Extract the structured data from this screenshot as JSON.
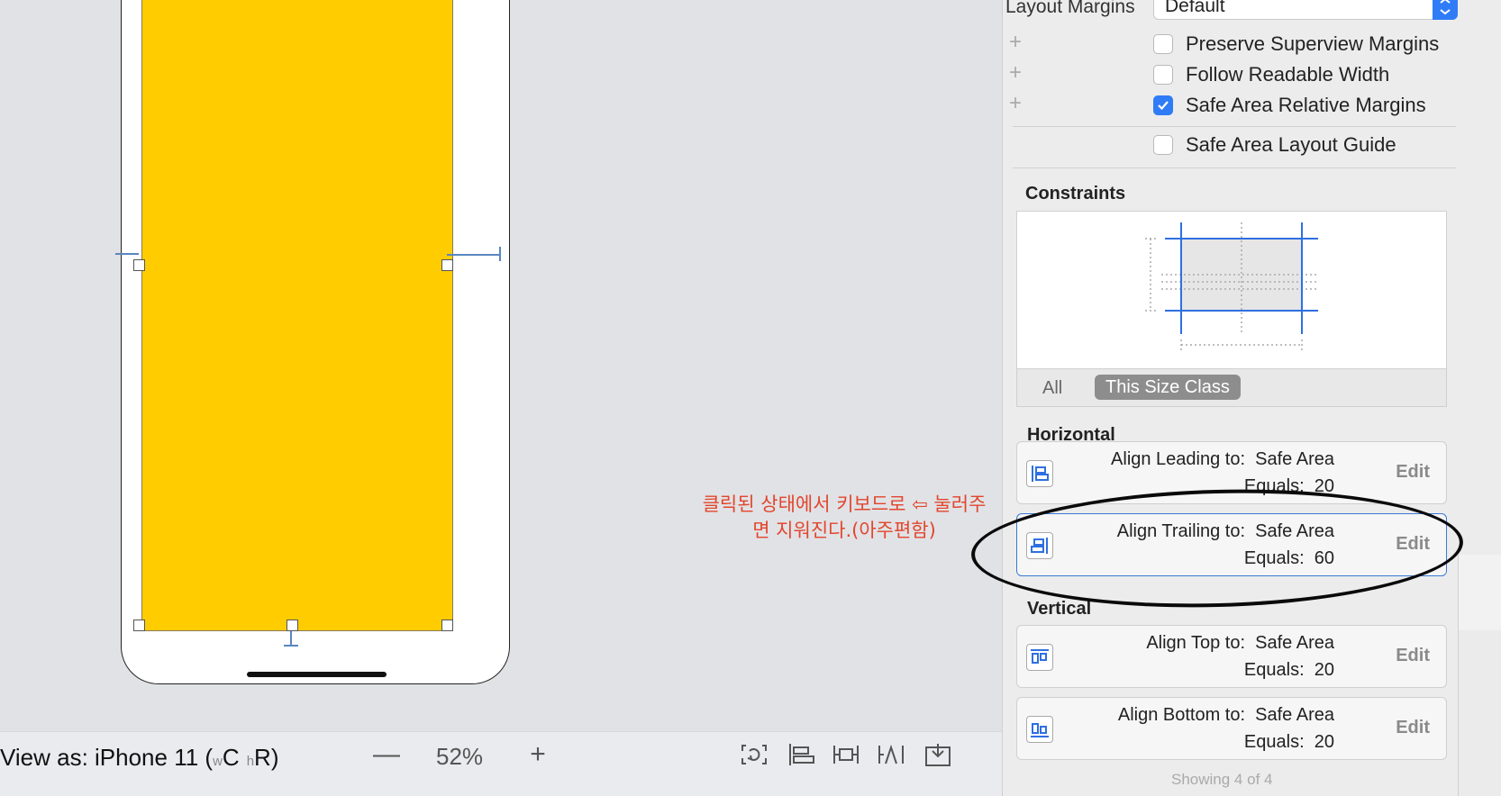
{
  "inspector": {
    "layout_margins_label": "Layout Margins",
    "layout_margins_value": "Default",
    "checkboxes": [
      {
        "label": "Preserve Superview Margins",
        "checked": false
      },
      {
        "label": "Follow Readable Width",
        "checked": false
      },
      {
        "label": "Safe Area Relative Margins",
        "checked": true
      },
      {
        "label": "Safe Area Layout Guide",
        "checked": false
      }
    ],
    "constraints_title": "Constraints",
    "size_class_tabs": [
      "All",
      "This Size Class"
    ],
    "selected_size_class": "This Size Class",
    "horizontal_title": "Horizontal",
    "vertical_title": "Vertical",
    "horizontal": [
      {
        "line1": "Align Leading to:  Safe Area",
        "line2": "Equals:  20",
        "edit": "Edit",
        "icon": "align-leading-icon"
      },
      {
        "line1": "Align Trailing to:  Safe Area",
        "line2": "Equals:  60",
        "edit": "Edit",
        "icon": "align-trailing-icon"
      }
    ],
    "vertical": [
      {
        "line1": "Align Top to:  Safe Area",
        "line2": "Equals:  20",
        "edit": "Edit",
        "icon": "align-top-icon"
      },
      {
        "line1": "Align Bottom to:  Safe Area",
        "line2": "Equals:  20",
        "edit": "Edit",
        "icon": "align-bottom-icon"
      }
    ],
    "showing": "Showing 4 of 4"
  },
  "canvas": {
    "view_color": "#ffcc00",
    "annotation_line1": "클릭된 상태에서 키보드로 ⇦ 눌러주",
    "annotation_line2": "면 지워진다.(아주편함)",
    "annotation_color": "#e2462d"
  },
  "bottombar": {
    "view_as_prefix": "View as: iPhone 11 (",
    "size_w": "w",
    "size_wc": "C",
    "size_h": "h",
    "size_hr": "R",
    "view_as_suffix": ")",
    "zoom": "52%",
    "icons": [
      "update-frames-icon",
      "embed-in-stack-icon",
      "align-icon",
      "add-constraints-icon",
      "resolve-issues-icon"
    ]
  },
  "colors": {
    "accent": "#2f7cf6",
    "selection_ring": "#0a0a0a"
  }
}
